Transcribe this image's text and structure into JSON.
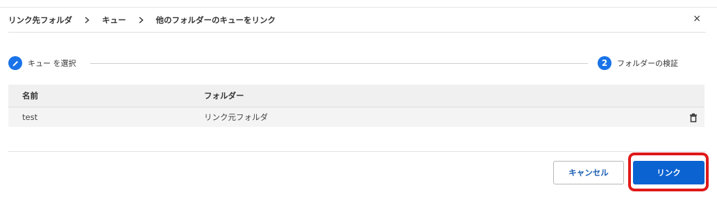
{
  "breadcrumb": {
    "items": [
      "リンク先フォルダ",
      "キュー",
      "他のフォルダーのキューをリンク"
    ],
    "separator": "›"
  },
  "header": {
    "close_symbol": "×"
  },
  "steps": [
    {
      "label": "キュー を選択",
      "state": "done",
      "icon": "pencil-icon"
    },
    {
      "label": "フォルダーの検証",
      "state": "current",
      "number": "2"
    }
  ],
  "table": {
    "columns": [
      "名前",
      "フォルダー"
    ],
    "rows": [
      {
        "name": "test",
        "folder": "リンク元フォルダ"
      }
    ]
  },
  "buttons": {
    "cancel_label": "キャンセル",
    "link_label": "リンク"
  },
  "colors": {
    "accent": "#0b63d1",
    "highlight": "#e01919"
  }
}
